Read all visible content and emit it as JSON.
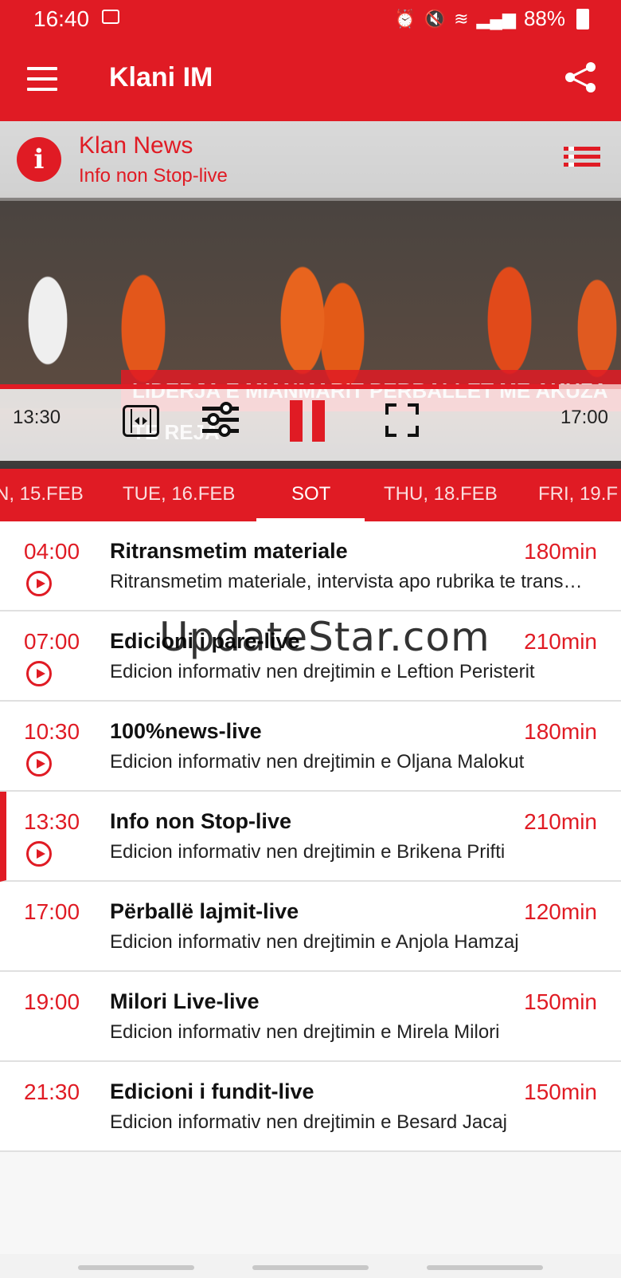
{
  "status_bar": {
    "time": "16:40",
    "battery": "88%",
    "icons": [
      "image-icon",
      "alarm-icon",
      "mute-icon",
      "wifi-icon",
      "signal-icon",
      "battery-icon"
    ]
  },
  "app_bar": {
    "title": "Klani IM",
    "menu_icon": "menu-icon",
    "share_icon": "share-icon"
  },
  "player": {
    "channel": "Klan News",
    "program": "Info non Stop-live",
    "lower_third": "LIDERJA E MIANMARIT PERBALLET ME AKUZA TE REJA",
    "start_time": "13:30",
    "end_time": "17:00",
    "progress": 0.9,
    "controls": [
      "aspect-ratio-icon",
      "settings-sliders-icon",
      "pause-icon",
      "fullscreen-icon"
    ]
  },
  "tabs": [
    {
      "label": "N, 15.FEB"
    },
    {
      "label": "TUE, 16.FEB"
    },
    {
      "label": "SOT"
    },
    {
      "label": "THU, 18.FEB"
    },
    {
      "label": "FRI, 19.F"
    }
  ],
  "active_tab": "SOT",
  "schedule": [
    {
      "time": "04:00",
      "title": "Ritransmetim materiale",
      "duration": "180min",
      "desc": "Ritransmetim materiale, intervista apo rubrika te transmetuara",
      "playable": true
    },
    {
      "time": "07:00",
      "title": "Edicioni i pare-live",
      "duration": "210min",
      "desc": "Edicion informativ nen drejtimin e Leftion Peristerit",
      "playable": true
    },
    {
      "time": "10:30",
      "title": "100%news-live",
      "duration": "180min",
      "desc": "Edicion informativ nen drejtimin e Oljana Malokut",
      "playable": true
    },
    {
      "time": "13:30",
      "title": "Info non Stop-live",
      "duration": "210min",
      "desc": "Edicion informativ nen drejtimin e Brikena Prifti",
      "playable": true,
      "current": true
    },
    {
      "time": "17:00",
      "title": "Përballë lajmit-live",
      "duration": "120min",
      "desc": "Edicion informativ nen drejtimin e Anjola Hamzaj",
      "playable": false
    },
    {
      "time": "19:00",
      "title": "Milori Live-live",
      "duration": "150min",
      "desc": "Edicion informativ nen drejtimin e Mirela Milori",
      "playable": false
    },
    {
      "time": "21:30",
      "title": "Edicioni i fundit-live",
      "duration": "150min",
      "desc": "Edicion informativ nen drejtimin e Besard Jacaj",
      "playable": false
    }
  ],
  "watermark": "UpdateStar.com",
  "colors": {
    "accent": "#e01b24",
    "text": "#111111",
    "background": "#f7f7f7"
  }
}
